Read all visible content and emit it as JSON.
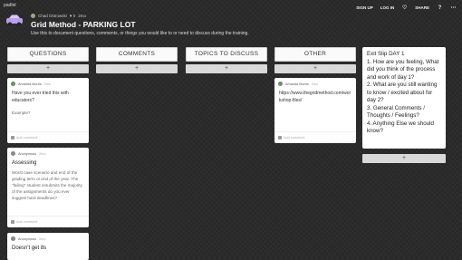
{
  "app": {
    "brand": "padlet"
  },
  "header": {
    "author": "Chad Ostrowski",
    "likes": "♥ 0",
    "time": "2mo",
    "title": "Grid Method - PARKING LOT",
    "subtitle": "Use this to document questions, comments, or things you would like to or need to discuss during the training."
  },
  "actions": {
    "signup": "SIGN UP",
    "login": "LOG IN",
    "share": "SHARE"
  },
  "columns": [
    {
      "label": "QUESTIONS",
      "add": "+"
    },
    {
      "label": "COMMENTS",
      "add": "+"
    },
    {
      "label": "TOPICS TO DISCUSS",
      "add": "+"
    },
    {
      "label": "OTHER",
      "add": "+"
    }
  ],
  "cards": {
    "q1": {
      "author": "Amanda Morris",
      "time": "2mo",
      "body": "Have you ever tried this with educators?",
      "sub": "Example?",
      "comment": "Add comment"
    },
    "q2": {
      "author": "Anonymous",
      "time": "2mo",
      "heading": "Assessing",
      "body": "Worst case scenario and end of the grading term or end of the year. The \"failing\" student resubmits the majority of the assignments do you ever suggest hard deadlines?",
      "comment": "Add comment"
    },
    "q3": {
      "author": "Anonymous",
      "time": "2mo",
      "heading": "Doesn't get 8s"
    },
    "o1": {
      "author": "Amanda Morris",
      "time": "2mo",
      "body": "https://www.thegridmethod.com/workshop-files/",
      "comment": "Add comment"
    }
  },
  "exit_slip": {
    "lines": [
      "Exit Slip DAY 1",
      "1. How are you feeling, What did you think of the process and work of day 1?",
      "2. What are you still wanting to know / excited about for day 2?",
      "3. General Comments / Thoughts / Feelings?",
      "4. Anything Else we should know?"
    ],
    "add": "+"
  }
}
